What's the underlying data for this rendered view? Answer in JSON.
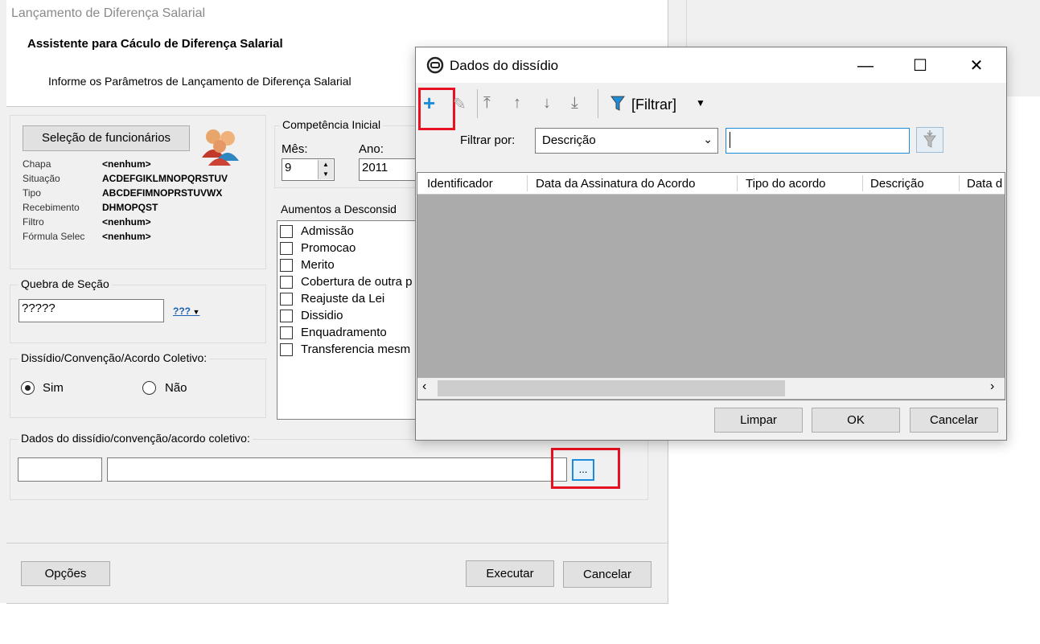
{
  "wizard": {
    "title": "Lançamento de Diferença Salarial",
    "heading": "Assistente para Cáculo de Diferença Salarial",
    "subheading": "Informe os Parâmetros de Lançamento de Diferença Salarial",
    "select_employees_label": "Seleção de funcionários",
    "params": [
      {
        "label": "Chapa",
        "value": "<nenhum>"
      },
      {
        "label": "Situação",
        "value": "ACDEFGIKLMNOPQRSTUV"
      },
      {
        "label": "Tipo",
        "value": "ABCDEFIMNOPRSTUVWX"
      },
      {
        "label": "Recebimento",
        "value": "DHMOPQST"
      },
      {
        "label": "Filtro",
        "value": "<nenhum>"
      },
      {
        "label": "Fórmula Selec",
        "value": "<nenhum>"
      }
    ],
    "competencia": {
      "title": "Competência Inicial",
      "month_label": "Mês:",
      "month_value": "9",
      "year_label": "Ano:",
      "year_value": "2011"
    },
    "section_break": {
      "title": "Quebra de Seção",
      "value": "?????",
      "button_glyph": "???"
    },
    "increases": {
      "title": "Aumentos a Desconsid",
      "items": [
        "Admissão",
        "Promocao",
        "Merito",
        "Cobertura de outra p",
        "Reajuste da Lei",
        "Dissidio",
        "Enquadramento",
        "Transferencia mesm"
      ]
    },
    "agreement": {
      "title": "Dissídio/Convenção/Acordo Coletivo:",
      "yes_label": "Sim",
      "no_label": "Não",
      "selected": "Sim"
    },
    "agreement_data": {
      "title": "Dados do dissídio/convenção/acordo coletivo:",
      "code_value": "",
      "desc_value": "",
      "browse_label": "..."
    },
    "buttons": {
      "options": "Opções",
      "execute": "Executar",
      "cancel": "Cancelar"
    }
  },
  "dialog": {
    "title": "Dados do dissídio",
    "filter_menu_label": "[Filtrar]",
    "filter_by_label": "Filtrar por:",
    "filter_field_value": "Descrição",
    "filter_text_value": "",
    "columns": [
      "Identificador",
      "Data da Assinatura do Acordo",
      "Tipo do acordo",
      "Descrição",
      "Data d"
    ],
    "buttons": {
      "clear": "Limpar",
      "ok": "OK",
      "cancel": "Cancelar"
    }
  },
  "colors": {
    "highlight": "#e81123",
    "accent": "#1a8cd8",
    "grid_bg": "#ababab"
  }
}
